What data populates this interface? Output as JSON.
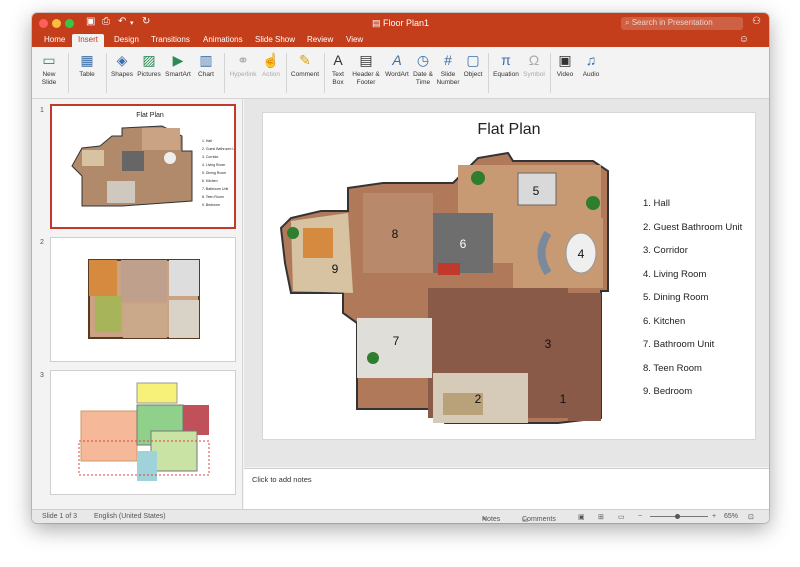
{
  "window": {
    "title": "Floor Plan1",
    "search_placeholder": "Search in Presentation"
  },
  "tabs": [
    "Home",
    "Insert",
    "Design",
    "Transitions",
    "Animations",
    "Slide Show",
    "Review",
    "View"
  ],
  "active_tab": "Insert",
  "ribbon": {
    "new_slide": "New Slide",
    "table": "Table",
    "shapes": "Shapes",
    "pictures": "Pictures",
    "smartart": "SmartArt",
    "chart": "Chart",
    "hyperlink": "Hyperlink",
    "action": "Action",
    "comment": "Comment",
    "text_box": "Text Box",
    "header_footer": "Header & Footer",
    "wordart": "WordArt",
    "date_time": "Date & Time",
    "slide_number": "Slide Number",
    "object": "Object",
    "equation": "Equation",
    "symbol": "Symbol",
    "video": "Video",
    "audio": "Audio"
  },
  "thumbnails": [
    {
      "number": "1",
      "title": "Flat Plan"
    },
    {
      "number": "2"
    },
    {
      "number": "3"
    }
  ],
  "slide": {
    "title": "Flat Plan",
    "legend": [
      "1. Hall",
      "2. Guest Bathroom Unit",
      "3. Corridor",
      "4. Living Room",
      "5. Dining Room",
      "6. Kitchen",
      "7. Bathroom Unit",
      "8. Teen Room",
      "9. Bedroom"
    ],
    "room_numbers": [
      "1",
      "2",
      "3",
      "4",
      "5",
      "6",
      "7",
      "8",
      "9"
    ]
  },
  "notes_placeholder": "Click to add notes",
  "status": {
    "slide_indicator": "Slide 1 of 3",
    "language": "English (United States)",
    "notes": "Notes",
    "comments": "Comments",
    "zoom": "65%"
  },
  "colors": {
    "accent": "#c43e1c",
    "selection": "#c0392b"
  }
}
